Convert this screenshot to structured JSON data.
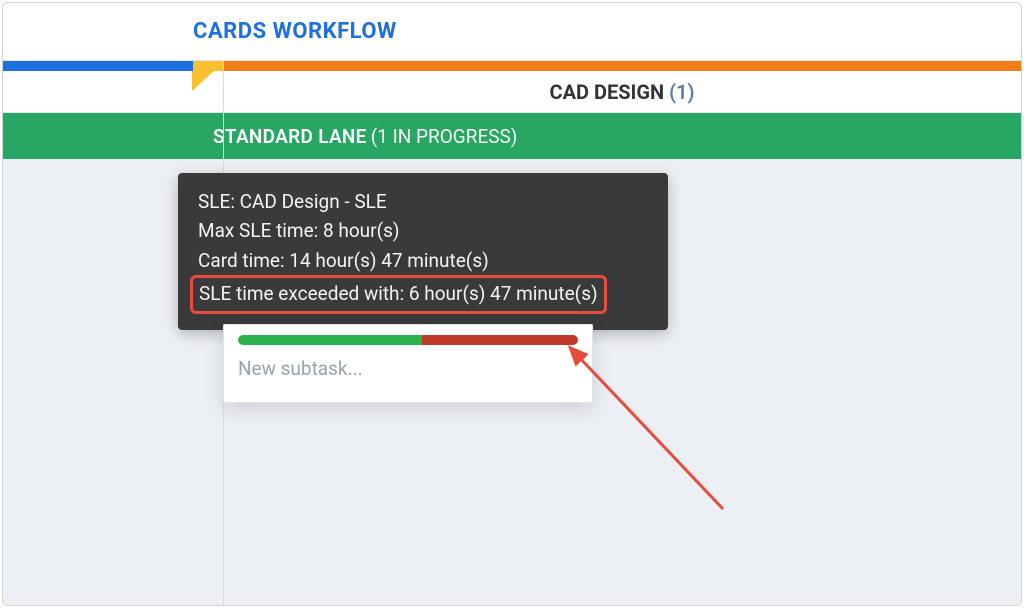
{
  "header": {
    "title": "CARDS WORKFLOW"
  },
  "column": {
    "name": "CAD DESIGN",
    "count_display": "(1)"
  },
  "lane": {
    "name": "STANDARD LANE",
    "status_display": "(1 IN PROGRESS)"
  },
  "card": {
    "subtask_placeholder": "New subtask...",
    "sle_ok_pct": 54,
    "sle_over_pct": 46
  },
  "tooltip": {
    "line1": "SLE: CAD Design - SLE",
    "line2": "Max SLE time: 8 hour(s)",
    "line3": "Card time: 14 hour(s) 47 minute(s)",
    "line4": "SLE time exceeded with: 6 hour(s) 47 minute(s)"
  },
  "colors": {
    "blue": "#1e6fe0",
    "orange": "#f07d1a",
    "yellow": "#fbc02d",
    "lane_green": "#27a664",
    "sle_green": "#2bb24c",
    "sle_red": "#c0392b",
    "annotation_red": "#e74c3c"
  }
}
